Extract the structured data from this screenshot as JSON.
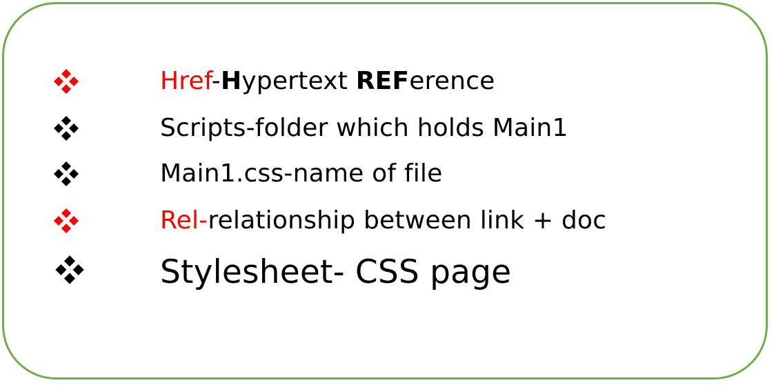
{
  "colors": {
    "border": "#70ad47",
    "accent": "#ff0000",
    "text": "#000000"
  },
  "bullet_icon": "four-diamond-bullet-icon",
  "items": [
    {
      "bullet_color": "#ff0000",
      "parts": [
        {
          "text": "Href",
          "red": true,
          "bold": false
        },
        {
          "text": "-",
          "red": false,
          "bold": false
        },
        {
          "text": "H",
          "red": false,
          "bold": true
        },
        {
          "text": "ypertext ",
          "red": false,
          "bold": false
        },
        {
          "text": "REF",
          "red": false,
          "bold": true
        },
        {
          "text": "erence",
          "red": false,
          "bold": false
        }
      ]
    },
    {
      "bullet_color": "#000000",
      "parts": [
        {
          "text": "Scripts-folder which holds Main1",
          "red": false,
          "bold": false
        }
      ]
    },
    {
      "bullet_color": "#000000",
      "parts": [
        {
          "text": "Main1.css-name of file",
          "red": false,
          "bold": false
        }
      ]
    },
    {
      "bullet_color": "#ff0000",
      "parts": [
        {
          "text": "Rel-",
          "red": true,
          "bold": false
        },
        {
          "text": "relationship between link + doc",
          "red": false,
          "bold": false
        }
      ]
    },
    {
      "bullet_color": "#000000",
      "parts": [
        {
          "text": "Stylesheet- CSS page",
          "red": false,
          "bold": false
        }
      ]
    }
  ]
}
